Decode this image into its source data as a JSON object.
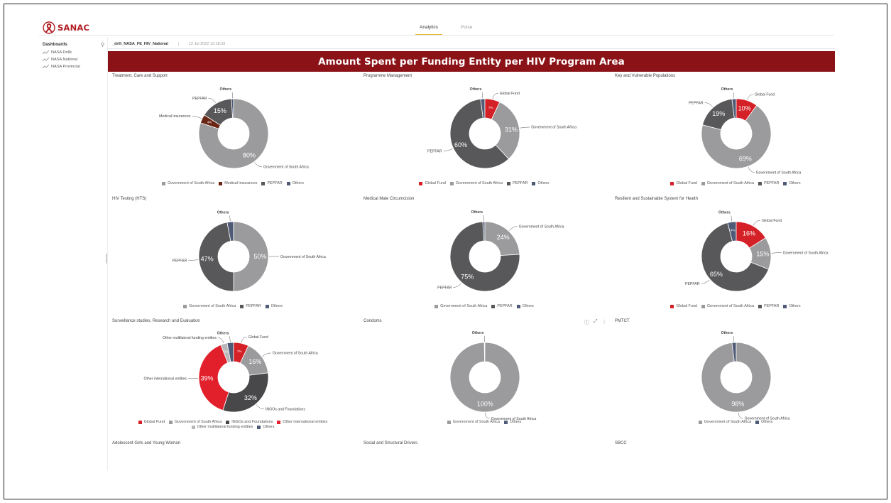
{
  "app": {
    "logo_text": "SANAC",
    "tabs": [
      {
        "label": "Analytics",
        "active": true
      },
      {
        "label": "Pulse",
        "active": false
      }
    ]
  },
  "sidebar": {
    "heading": "Dashboards",
    "items": [
      {
        "label": "NASA Drills"
      },
      {
        "label": "NASA National"
      },
      {
        "label": "NASA Provincial"
      }
    ]
  },
  "breadcrumb": {
    "dashboard_name": "_drill_NASA_FE_HIV_National",
    "date": "12 Jul 2022 13:18:33"
  },
  "banner": {
    "title": "Amount Spent per Funding Entity per HIV Program Area"
  },
  "colors": {
    "Global Fund": "#d42027",
    "Government of South Africa": "#9b9b9d",
    "Medical insurances": "#6a2614",
    "PEPFAR": "#58585a",
    "Others": "#4e5a76",
    "INGOs and Foundations": "#48484a",
    "Other international entities": "#e2202c",
    "Other multilateral funding entities": "#b8b8bb",
    "brand": "#8b1318",
    "accent": "#e5b52e"
  },
  "chart_data": [
    {
      "type": "pie",
      "title": "Treatment, Care and Support",
      "categories": [
        "Government of South Africa",
        "Medical insurances",
        "PEPFAR",
        "Others"
      ],
      "values": [
        80,
        4,
        15,
        1
      ],
      "data_labels": [
        "80%",
        "4%",
        "15%",
        ""
      ],
      "legend": "bottom"
    },
    {
      "type": "pie",
      "title": "Programme Management",
      "categories": [
        "Global Fund",
        "Government of South Africa",
        "PEPFAR",
        "Others"
      ],
      "values": [
        7,
        31,
        60,
        2
      ],
      "data_labels": [
        "7%",
        "31%",
        "60%",
        ""
      ],
      "legend": "bottom"
    },
    {
      "type": "pie",
      "title": "Key and Vulnerable Populations",
      "categories": [
        "Global Fund",
        "Government of South Africa",
        "PEPFAR",
        "Others"
      ],
      "values": [
        10,
        69,
        19,
        2
      ],
      "data_labels": [
        "10%",
        "69%",
        "19%",
        ""
      ],
      "legend": "bottom"
    },
    {
      "type": "pie",
      "title": "HIV Testing (HTS)",
      "categories": [
        "Government of South Africa",
        "PEPFAR",
        "Others"
      ],
      "values": [
        50,
        47,
        3
      ],
      "data_labels": [
        "50%",
        "47%",
        ""
      ],
      "legend": "bottom"
    },
    {
      "type": "pie",
      "title": "Medical Male Circumcision",
      "categories": [
        "Government of South Africa",
        "PEPFAR",
        "Others"
      ],
      "values": [
        24,
        75,
        1
      ],
      "data_labels": [
        "24%",
        "75%",
        ""
      ],
      "legend": "bottom"
    },
    {
      "type": "pie",
      "title": "Resilient and Sustainable System for Health",
      "categories": [
        "Global Fund",
        "Government of South Africa",
        "PEPFAR",
        "Others"
      ],
      "values": [
        16,
        15,
        65,
        4
      ],
      "data_labels": [
        "16%",
        "15%",
        "65%",
        "4%"
      ],
      "legend": "bottom"
    },
    {
      "type": "pie",
      "title": "Surveillance studies, Research and Evaluation",
      "categories": [
        "Global Fund",
        "Government of South Africa",
        "INGOs and Foundations",
        "Other international entities",
        "Other multilateral funding entities",
        "Others"
      ],
      "values": [
        7,
        16,
        32,
        39,
        3,
        3
      ],
      "data_labels": [
        "7%",
        "16%",
        "32%",
        "39%",
        "3%",
        ""
      ],
      "legend": "bottom"
    },
    {
      "type": "pie",
      "title": "Condoms",
      "categories": [
        "Government of South Africa",
        "Others"
      ],
      "values": [
        100,
        0.3
      ],
      "data_labels": [
        "100%",
        ""
      ],
      "legend": "bottom"
    },
    {
      "type": "pie",
      "title": "PMTCT",
      "categories": [
        "Government of South Africa",
        "Others"
      ],
      "values": [
        98,
        2
      ],
      "data_labels": [
        "98%",
        ""
      ],
      "legend": "bottom"
    },
    {
      "type": "pie",
      "title": "Adolescent Girls and Young Woman",
      "categories": [],
      "values": []
    },
    {
      "type": "pie",
      "title": "Social and Structural Drivers",
      "categories": [],
      "values": []
    },
    {
      "type": "pie",
      "title": "SBCC",
      "categories": [],
      "values": []
    }
  ],
  "panel_toolbar": {
    "info_icon": "info-icon",
    "expand_icon": "expand-icon",
    "more_icon": "more-icon"
  }
}
